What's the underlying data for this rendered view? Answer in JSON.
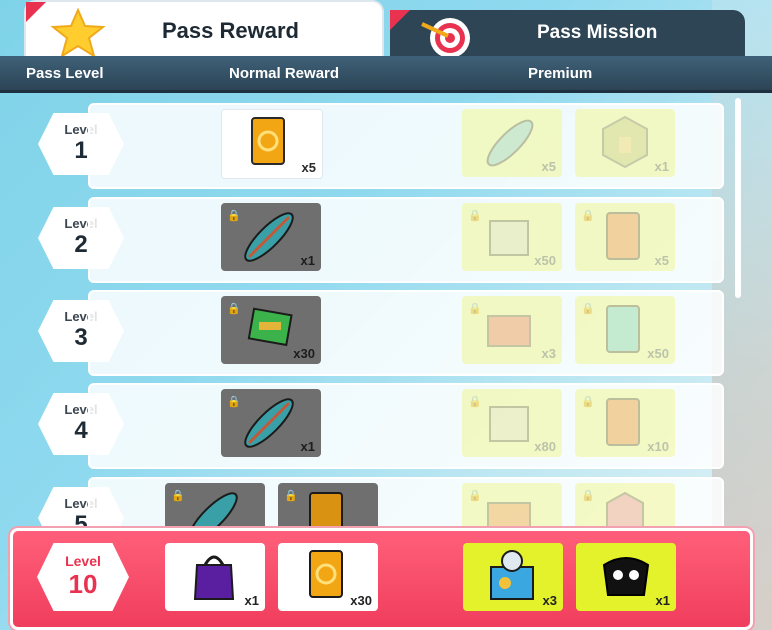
{
  "tabs": [
    {
      "label": "Pass Reward",
      "icon": "star-icon",
      "active": true
    },
    {
      "label": "Pass Mission",
      "icon": "target-icon",
      "active": false
    }
  ],
  "columns": {
    "level": "Pass Level",
    "normal": "Normal Reward",
    "premium": "Premium"
  },
  "level_word": "Level",
  "rows": [
    {
      "level": "1",
      "normal": [
        {
          "item": "card-icon",
          "qty": "x5",
          "locked": false
        }
      ],
      "premium": [
        {
          "item": "surfboard-icon",
          "qty": "x5"
        },
        {
          "item": "thumbs-up-badge-icon",
          "qty": "x1"
        }
      ]
    },
    {
      "level": "2",
      "normal": [
        {
          "item": "surfboard-icon",
          "qty": "x1",
          "locked": true
        }
      ],
      "premium": [
        {
          "item": "mystery-box-icon",
          "qty": "x50"
        },
        {
          "item": "card-icon",
          "qty": "x5"
        }
      ]
    },
    {
      "level": "3",
      "normal": [
        {
          "item": "ticket-icon",
          "qty": "x30",
          "locked": true
        }
      ],
      "premium": [
        {
          "item": "chest-icon",
          "qty": "x3"
        },
        {
          "item": "card-icon",
          "qty": "x50"
        }
      ]
    },
    {
      "level": "4",
      "normal": [
        {
          "item": "surfboard-icon",
          "qty": "x1",
          "locked": true
        }
      ],
      "premium": [
        {
          "item": "mystery-box-icon",
          "qty": "x80"
        },
        {
          "item": "card-icon",
          "qty": "x10"
        }
      ]
    },
    {
      "level": "5",
      "normal": [
        {
          "item": "surfboard-icon",
          "qty": "",
          "locked": true
        },
        {
          "item": "card-icon",
          "qty": "",
          "locked": true
        }
      ],
      "premium": [
        {
          "item": "chest-icon",
          "qty": ""
        },
        {
          "item": "badge-icon",
          "qty": ""
        }
      ]
    }
  ],
  "featured": {
    "level_word": "Level",
    "level": "10",
    "normal": [
      {
        "item": "shopping-bag-icon",
        "qty": "x1"
      },
      {
        "item": "card-icon",
        "qty": "x30"
      }
    ],
    "premium": [
      {
        "item": "fan-box-icon",
        "qty": "x3"
      },
      {
        "item": "outfit-icon",
        "qty": "x1"
      }
    ]
  },
  "colors": {
    "accent": "#e8324f",
    "header": "#2e4556",
    "premium_slot": "#e3f22a",
    "card": "#f3a614"
  }
}
